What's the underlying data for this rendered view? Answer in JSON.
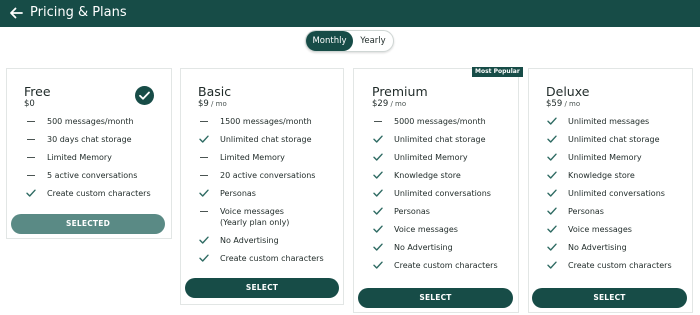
{
  "header": {
    "title": "Pricing & Plans",
    "back_icon": "back-arrow-icon"
  },
  "toggle": {
    "monthly_label": "Monthly",
    "yearly_label": "Yearly",
    "selected": "Monthly"
  },
  "colors": {
    "brand": "#174c47",
    "selected_button": "#5a8a85"
  },
  "plans": [
    {
      "name": "Free",
      "price": "$0",
      "per": "",
      "button_label": "SELECTED",
      "current": true,
      "features": [
        {
          "text": "500 messages/month",
          "included": false
        },
        {
          "text": "30 days chat storage",
          "included": false
        },
        {
          "text": "Limited Memory",
          "included": false
        },
        {
          "text": "5 active conversations",
          "included": false
        },
        {
          "text": "Create custom characters",
          "included": true
        }
      ]
    },
    {
      "name": "Basic",
      "price": "$9",
      "per": " / mo",
      "button_label": "SELECT",
      "current": false,
      "features": [
        {
          "text": "1500 messages/month",
          "included": false
        },
        {
          "text": "Unlimited chat storage",
          "included": true
        },
        {
          "text": "Limited Memory",
          "included": false
        },
        {
          "text": "20 active conversations",
          "included": false
        },
        {
          "text": "Personas",
          "included": true
        },
        {
          "text": "Voice messages",
          "included": false
        },
        {
          "text": "(Yearly plan only)",
          "included": false,
          "continuation": true
        },
        {
          "text": "No Advertising",
          "included": true
        },
        {
          "text": "Create custom characters",
          "included": true
        }
      ]
    },
    {
      "name": "Premium",
      "price": "$29",
      "per": " / mo",
      "badge": "Most Popular",
      "button_label": "SELECT",
      "current": false,
      "features": [
        {
          "text": "5000 messages/month",
          "included": false
        },
        {
          "text": "Unlimited chat storage",
          "included": true
        },
        {
          "text": "Unlimited Memory",
          "included": true
        },
        {
          "text": "Knowledge store",
          "included": true
        },
        {
          "text": "Unlimited conversations",
          "included": true
        },
        {
          "text": "Personas",
          "included": true
        },
        {
          "text": "Voice messages",
          "included": true
        },
        {
          "text": "No Advertising",
          "included": true
        },
        {
          "text": "Create custom characters",
          "included": true
        }
      ]
    },
    {
      "name": "Deluxe",
      "price": "$59",
      "per": " / mo",
      "button_label": "SELECT",
      "current": false,
      "features": [
        {
          "text": "Unlimited messages",
          "included": true
        },
        {
          "text": "Unlimited chat storage",
          "included": true
        },
        {
          "text": "Unlimited Memory",
          "included": true
        },
        {
          "text": "Knowledge store",
          "included": true
        },
        {
          "text": "Unlimited conversations",
          "included": true
        },
        {
          "text": "Personas",
          "included": true
        },
        {
          "text": "Voice messages",
          "included": true
        },
        {
          "text": "No Advertising",
          "included": true
        },
        {
          "text": "Create custom characters",
          "included": true
        }
      ]
    }
  ]
}
